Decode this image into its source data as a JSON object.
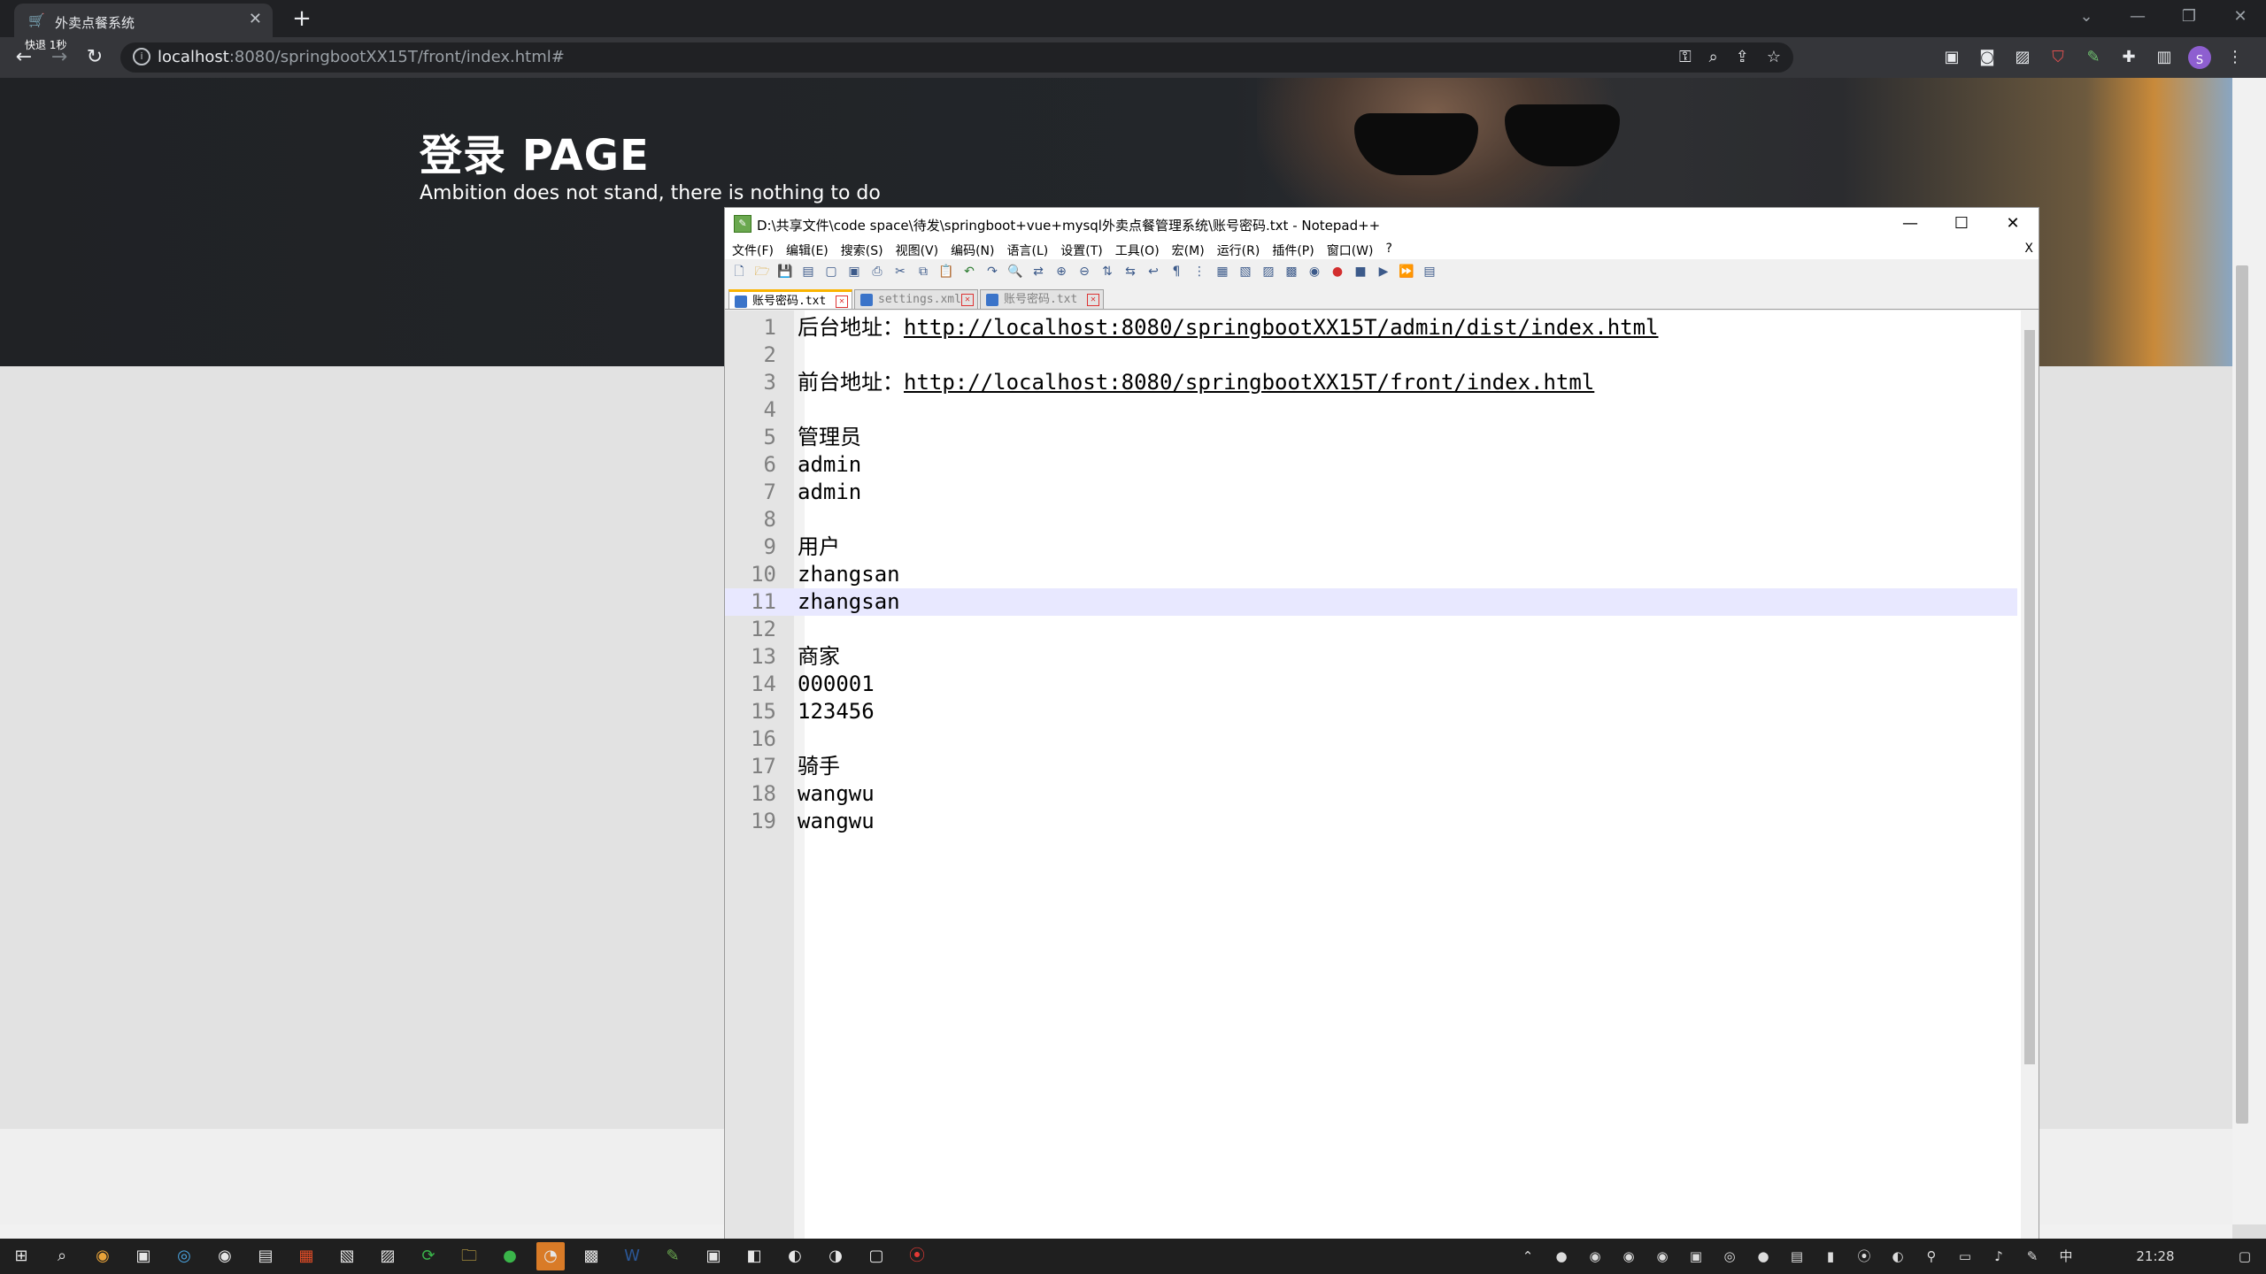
{
  "browser": {
    "tab_title": "外卖点餐系统",
    "tab_favicon": "cart-icon",
    "tooltip": "快退 1秒",
    "url_host": "localhost",
    "url_rest": ":8080/springbootXX15T/front/index.html#"
  },
  "hero": {
    "title": "登录 PAGE",
    "subtitle": "Ambition does not stand, there is nothing to do"
  },
  "npp": {
    "title": "D:\\共享文件\\code space\\待发\\springboot+vue+mysql外卖点餐管理系统\\账号密码.txt - Notepad++",
    "menu": [
      "文件(F)",
      "编辑(E)",
      "搜索(S)",
      "视图(V)",
      "编码(N)",
      "语言(L)",
      "设置(T)",
      "工具(O)",
      "宏(M)",
      "运行(R)",
      "插件(P)",
      "窗口(W)",
      "?"
    ],
    "menu_close": "X",
    "tabs": [
      "账号密码.txt",
      "settings.xml",
      "账号密码.txt"
    ],
    "lines": [
      {
        "n": "1",
        "label": "后台地址：",
        "link": "http://localhost:8080/springbootXX15T/admin/dist/index.html"
      },
      {
        "n": "2",
        "label": "",
        "link": ""
      },
      {
        "n": "3",
        "label": "前台地址：",
        "link": "http://localhost:8080/springbootXX15T/front/index.html"
      },
      {
        "n": "4",
        "label": "",
        "link": ""
      },
      {
        "n": "5",
        "label": "管理员",
        "link": ""
      },
      {
        "n": "6",
        "label": "admin",
        "link": ""
      },
      {
        "n": "7",
        "label": "admin",
        "link": ""
      },
      {
        "n": "8",
        "label": "",
        "link": ""
      },
      {
        "n": "9",
        "label": "用户",
        "link": ""
      },
      {
        "n": "10",
        "label": "zhangsan",
        "link": ""
      },
      {
        "n": "11",
        "label": "zhangsan",
        "link": ""
      },
      {
        "n": "12",
        "label": "",
        "link": ""
      },
      {
        "n": "13",
        "label": "商家",
        "link": ""
      },
      {
        "n": "14",
        "label": "000001",
        "link": ""
      },
      {
        "n": "15",
        "label": "123456",
        "link": ""
      },
      {
        "n": "16",
        "label": "",
        "link": ""
      },
      {
        "n": "17",
        "label": "骑手",
        "link": ""
      },
      {
        "n": "18",
        "label": "wangwu",
        "link": ""
      },
      {
        "n": "19",
        "label": "wangwu",
        "link": ""
      }
    ],
    "highlight_line": "11"
  },
  "profile_initial": "S",
  "clock": "21:28",
  "colors": {
    "chrome_dark": "#202124",
    "chrome_toolbar": "#35363a",
    "hero_bg": "#202225",
    "npp_current_line": "#e8e8ff",
    "taskbar": "#1f1f1f"
  }
}
